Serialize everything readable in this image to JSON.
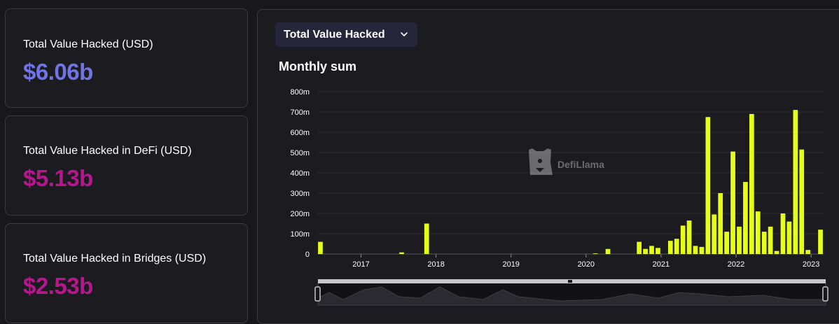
{
  "cards": [
    {
      "label": "Total Value Hacked (USD)",
      "value": "$6.06b",
      "color": "#7074e6"
    },
    {
      "label": "Total Value Hacked in DeFi (USD)",
      "value": "$5.13b",
      "color": "#b7168f"
    },
    {
      "label": "Total Value Hacked in Bridges (USD)",
      "value": "$2.53b",
      "color": "#b7168f"
    }
  ],
  "dropdown": {
    "label": "Total Value Hacked",
    "icon": "chevron-down-icon"
  },
  "watermark": {
    "text": "DefiLlama",
    "icon": "llama-logo-icon"
  },
  "colors": {
    "bar": "#e6ff19",
    "background": "#18181b",
    "panel": "#1c1c20",
    "border": "#3a3a40"
  },
  "chart_data": {
    "type": "bar",
    "title": "Monthly sum",
    "xlabel": "",
    "ylabel": "",
    "ylim": [
      0,
      800
    ],
    "y_unit": "m",
    "y_ticks": [
      "0",
      "100m",
      "200m",
      "300m",
      "400m",
      "500m",
      "600m",
      "700m",
      "800m"
    ],
    "x_ticks": [
      "2017",
      "2018",
      "2019",
      "2020",
      "2021",
      "2022",
      "2023"
    ],
    "grid": "horizontal",
    "legend": "none",
    "x_range": [
      "2016-06",
      "2023-02"
    ],
    "points": [
      {
        "month": "2016-06",
        "value": 60
      },
      {
        "month": "2017-07",
        "value": 8
      },
      {
        "month": "2017-11",
        "value": 150
      },
      {
        "month": "2020-02",
        "value": 3
      },
      {
        "month": "2020-04",
        "value": 25
      },
      {
        "month": "2020-09",
        "value": 60
      },
      {
        "month": "2020-10",
        "value": 25
      },
      {
        "month": "2020-11",
        "value": 40
      },
      {
        "month": "2020-12",
        "value": 30
      },
      {
        "month": "2021-02",
        "value": 65
      },
      {
        "month": "2021-03",
        "value": 75
      },
      {
        "month": "2021-04",
        "value": 140
      },
      {
        "month": "2021-05",
        "value": 165
      },
      {
        "month": "2021-06",
        "value": 40
      },
      {
        "month": "2021-07",
        "value": 35
      },
      {
        "month": "2021-08",
        "value": 675
      },
      {
        "month": "2021-09",
        "value": 195
      },
      {
        "month": "2021-10",
        "value": 300
      },
      {
        "month": "2021-11",
        "value": 110
      },
      {
        "month": "2021-12",
        "value": 505
      },
      {
        "month": "2022-01",
        "value": 135
      },
      {
        "month": "2022-02",
        "value": 355
      },
      {
        "month": "2022-03",
        "value": 690
      },
      {
        "month": "2022-04",
        "value": 210
      },
      {
        "month": "2022-05",
        "value": 110
      },
      {
        "month": "2022-06",
        "value": 135
      },
      {
        "month": "2022-07",
        "value": 15
      },
      {
        "month": "2022-08",
        "value": 200
      },
      {
        "month": "2022-09",
        "value": 160
      },
      {
        "month": "2022-10",
        "value": 710
      },
      {
        "month": "2022-11",
        "value": 515
      },
      {
        "month": "2022-12",
        "value": 20
      },
      {
        "month": "2023-02",
        "value": 120
      }
    ]
  }
}
